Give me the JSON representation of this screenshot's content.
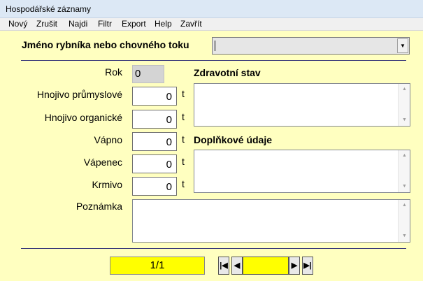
{
  "window": {
    "title": "Hospodářské záznamy"
  },
  "menu": [
    "Nový",
    "Zrušit",
    "Najdi",
    "Filtr",
    "Export",
    "Help",
    "Zavřít"
  ],
  "pond": {
    "label": "Jméno rybníka nebo chovného toku",
    "value": ""
  },
  "fields": {
    "rok": {
      "label": "Rok",
      "value": "0"
    },
    "hnojivo_prumyslove": {
      "label": "Hnojivo průmyslové",
      "value": "0",
      "unit": "t"
    },
    "hnojivo_organicke": {
      "label": "Hnojivo organické",
      "value": "0",
      "unit": "t"
    },
    "vapno": {
      "label": "Vápno",
      "value": "0",
      "unit": "t"
    },
    "vapenec": {
      "label": "Vápenec",
      "value": "0",
      "unit": "t"
    },
    "krmivo": {
      "label": "Krmivo",
      "value": "0",
      "unit": "t"
    }
  },
  "notes": {
    "zdravotni_stav": "Zdravotní stav",
    "doplnkove_udaje": "Doplňkové údaje",
    "poznamka": "Poznámka"
  },
  "record_counter": "1/1"
}
